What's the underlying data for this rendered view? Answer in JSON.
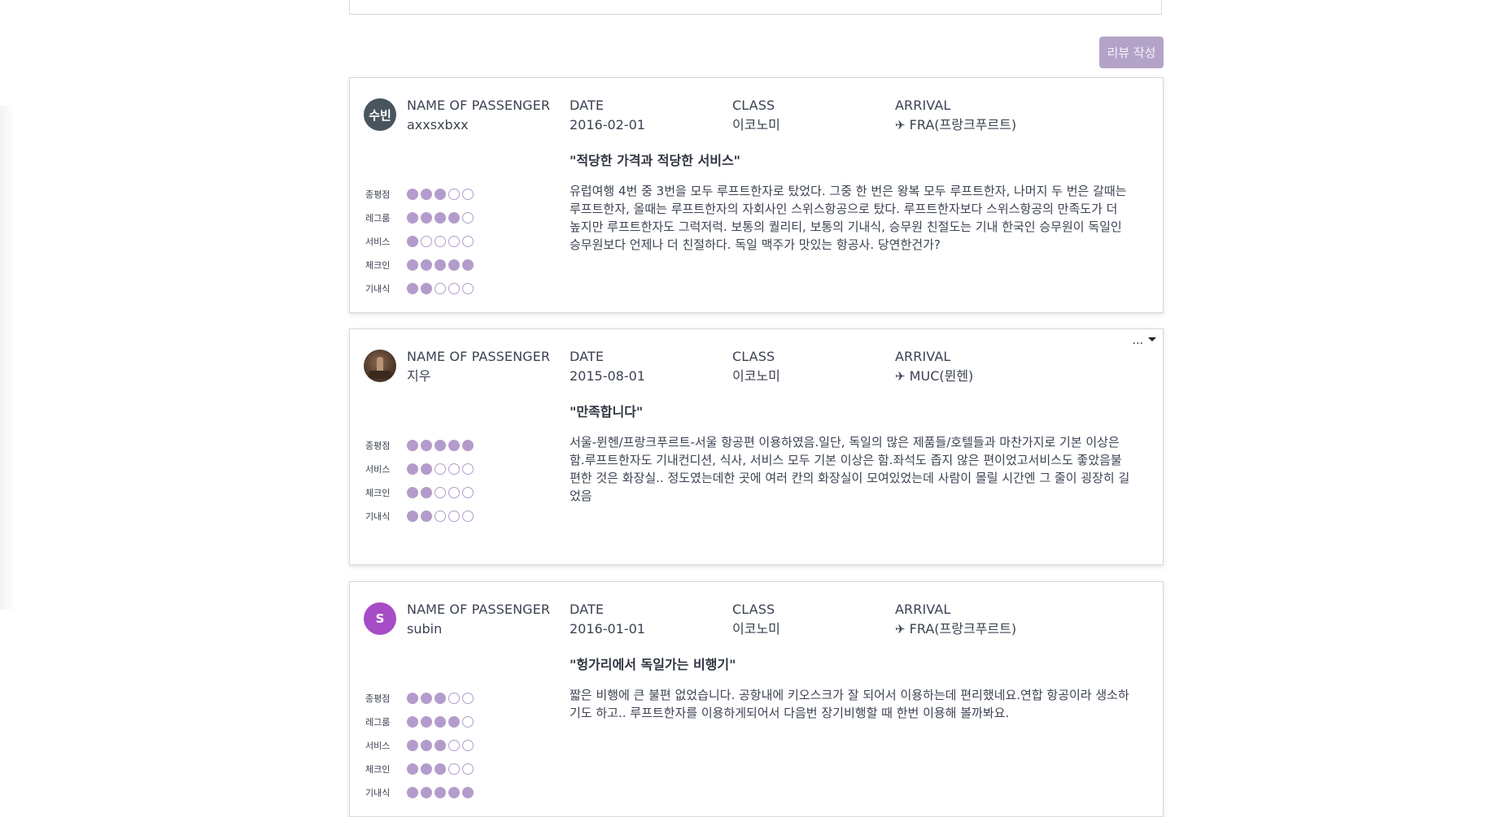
{
  "write_button": "리뷰 작성",
  "labels": {
    "passenger": "NAME OF PASSENGER",
    "date": "DATE",
    "class": "CLASS",
    "arrival": "ARRIVAL"
  },
  "more_menu": "...",
  "colors": {
    "accent": "#b39ccb",
    "button": "#b4a3c8"
  },
  "reviews": [
    {
      "avatar_text": "수빈",
      "avatar_color": "#49555d",
      "name": "axxsxbxx",
      "date": "2016-02-01",
      "class": "이코노미",
      "arrival_icon": "✈",
      "arrival": "FRA(프랑크푸르트)",
      "title": "\"적당한 가격과 적당한 서비스\"",
      "body": "유럽여행 4번 중 3번을 모두 루프트한자로 탔었다. 그중 한 번은 왕복 모두 루프트한자, 나머지 두 번은 갈때는 루프트한자, 올때는 루프트한자의 자회사인 스위스항공으로 탔다. 루프트한자보다 스위스항공의 만족도가 더 높지만 루프트한자도 그럭저럭. 보통의 퀄리티, 보통의 기내식, 승무원 친절도는 기내 한국인 승무원이 독일인 승무원보다 언제나 더 친절하다. 독일 맥주가 맛있는 항공사. 당연한건가?",
      "ratings": [
        {
          "label": "종평점",
          "score": 3
        },
        {
          "label": "레그룸",
          "score": 4
        },
        {
          "label": "서비스",
          "score": 1
        },
        {
          "label": "체크인",
          "score": 5
        },
        {
          "label": "기내식",
          "score": 2
        }
      ]
    },
    {
      "avatar_text": "",
      "avatar_color": "#5b4332",
      "name": "지우",
      "date": "2015-08-01",
      "class": "이코노미",
      "arrival_icon": "✈",
      "arrival": "MUC(뮌헨)",
      "title": "\"만족합니다\"",
      "body": "서울-뮌헨/프랑크푸르트-서울 항공편 이용하였음.일단, 독일의 많은 제품들/호텔들과 마찬가지로 기본 이상은 함.루프트한자도 기내컨디션, 식사, 서비스 모두 기본 이상은 함.좌석도 좁지 않은 편이었고서비스도 좋았음불편한 것은 화장실.. 정도였는데한 곳에 여러 칸의 화장실이 모여있었는데 사람이 몰릴 시간엔 그 줄이 굉장히 길었음",
      "ratings": [
        {
          "label": "종평점",
          "score": 5
        },
        {
          "label": "서비스",
          "score": 2
        },
        {
          "label": "체크인",
          "score": 2
        },
        {
          "label": "기내식",
          "score": 2
        }
      ]
    },
    {
      "avatar_text": "S",
      "avatar_color": "#a64cc4",
      "name": "subin",
      "date": "2016-01-01",
      "class": "이코노미",
      "arrival_icon": "✈",
      "arrival": "FRA(프랑크푸르트)",
      "title": "\"헝가리에서 독일가는 비행기\"",
      "body": "짧은 비행에 큰 불편 없었습니다. 공항내에 키오스크가 잘 되어서 이용하는데 편리했네요.연합 항공이라 생소하기도 하고.. 루프트한자를 이용하게되어서 다음번 장기비행할 때 한번 이용해 볼까봐요.",
      "ratings": [
        {
          "label": "종평점",
          "score": 3
        },
        {
          "label": "레그룸",
          "score": 4
        },
        {
          "label": "서비스",
          "score": 3
        },
        {
          "label": "체크인",
          "score": 3
        },
        {
          "label": "기내식",
          "score": 5
        }
      ]
    }
  ]
}
